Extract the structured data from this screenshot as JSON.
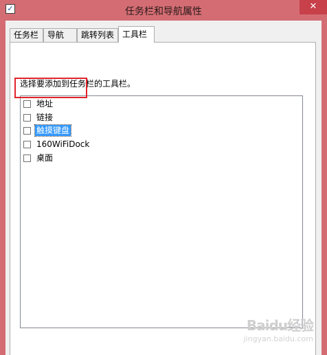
{
  "window": {
    "title": "任务栏和导航属性",
    "icon": "checkmark-document-icon",
    "close_label": "✕"
  },
  "tabs": [
    {
      "label": "任务栏",
      "active": false
    },
    {
      "label": "导航",
      "active": false
    },
    {
      "label": "跳转列表",
      "active": false
    },
    {
      "label": "工具栏",
      "active": true
    }
  ],
  "toolbars_page": {
    "instruction": "选择要添加到任务栏的工具栏。",
    "items": [
      {
        "label": "地址",
        "checked": false
      },
      {
        "label": "链接",
        "checked": false
      },
      {
        "label": "触摸键盘",
        "checked": false,
        "selected": true
      },
      {
        "label": "160WiFiDock",
        "checked": false
      },
      {
        "label": "桌面",
        "checked": false
      }
    ]
  },
  "annotation": {
    "color": "#e0222a"
  },
  "watermark": {
    "logo": "Baidu经验",
    "sub": "jingyan.baidu.com"
  },
  "colors": {
    "titlebar": "#d46d73",
    "close": "#c7404a",
    "selection": "#3399ff"
  }
}
